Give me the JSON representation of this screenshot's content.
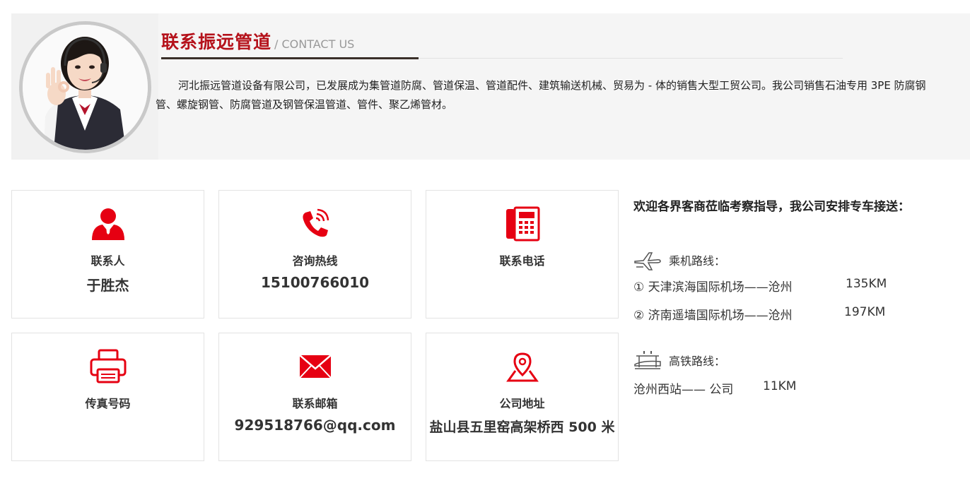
{
  "header": {
    "title_cn": "联系振远管道",
    "title_en": "/ CONTACT US",
    "intro": "河北振远管道设备有限公司，已发展成为集管道防腐、管道保温、管道配件、建筑输送机械、贸易为 - 体的销售大型工贸公司。我公司销售石油专用 3PE 防腐钢管、螺旋钢管、防腐管道及钢管保温管道、管件、聚乙烯管材。"
  },
  "cards": [
    {
      "icon": "person-icon",
      "label": "联系人",
      "value": "于胜杰"
    },
    {
      "icon": "phone-ringing-icon",
      "label": "咨询热线",
      "value": "15100766010"
    },
    {
      "icon": "desk-phone-icon",
      "label": "联系电话",
      "value": ""
    },
    {
      "icon": "printer-icon",
      "label": "传真号码",
      "value": ""
    },
    {
      "icon": "envelope-icon",
      "label": "联系邮箱",
      "value": "929518766@qq.com"
    },
    {
      "icon": "location-pin-icon",
      "label": "公司地址",
      "value": "盐山县五里窑高架桥西 500 米"
    }
  ],
  "routes": {
    "welcome": "欢迎各界客商莅临考察指导，我公司安排专车接送：",
    "air_title": "乘机路线：",
    "air": [
      {
        "route": "① 天津滨海国际机场——沧州",
        "distance": "135KM"
      },
      {
        "route": "② 济南遥墙国际机场——沧州",
        "distance": "197KM"
      }
    ],
    "rail_title": "高铁路线：",
    "rail": [
      {
        "route": "沧州西站—— 公司",
        "distance": "11KM"
      }
    ]
  },
  "colors": {
    "accent": "#e60012",
    "title_red": "#b5121b",
    "band_bg": "#f5f5f5"
  }
}
